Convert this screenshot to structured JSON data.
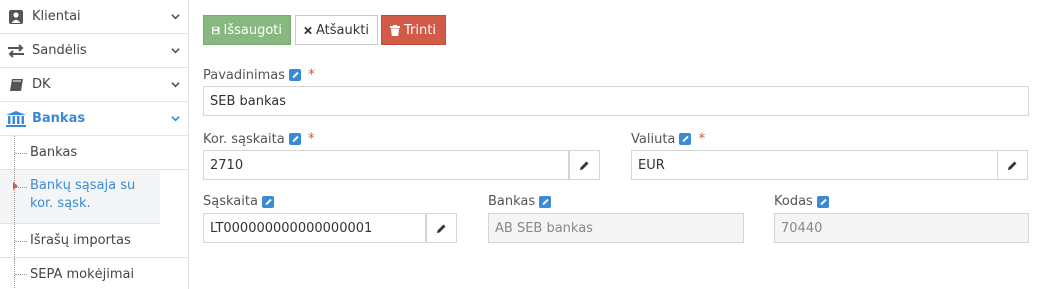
{
  "sidebar": {
    "items": [
      {
        "label": "Klientai",
        "icon": "user-icon"
      },
      {
        "label": "Sandėlis",
        "icon": "exchange-icon"
      },
      {
        "label": "DK",
        "icon": "book-icon"
      },
      {
        "label": "Bankas",
        "icon": "bank-icon"
      }
    ],
    "subitems": [
      {
        "label": "Bankas"
      },
      {
        "label": "Bankų sąsaja su kor. sąsk."
      },
      {
        "label": "Išrašų importas"
      },
      {
        "label": "SEPA mokėjimai"
      }
    ],
    "accent_color": "#3b8ad6"
  },
  "toolbar": {
    "save_label": "Išsaugoti",
    "cancel_label": "Atšaukti",
    "delete_label": "Trinti",
    "save_color": "#87b87f",
    "delete_color": "#d15b47"
  },
  "form": {
    "pavadinimas": {
      "label": "Pavadinimas",
      "value": "SEB bankas",
      "required": "*"
    },
    "kor_saskaita": {
      "label": "Kor. sąskaita",
      "value": "2710",
      "required": "*"
    },
    "valiuta": {
      "label": "Valiuta",
      "value": "EUR",
      "required": "*"
    },
    "saskaita": {
      "label": "Sąskaita",
      "value": "LT000000000000000001"
    },
    "bankas": {
      "label": "Bankas",
      "value": "AB SEB bankas"
    },
    "kodas": {
      "label": "Kodas",
      "value": "70440"
    }
  }
}
